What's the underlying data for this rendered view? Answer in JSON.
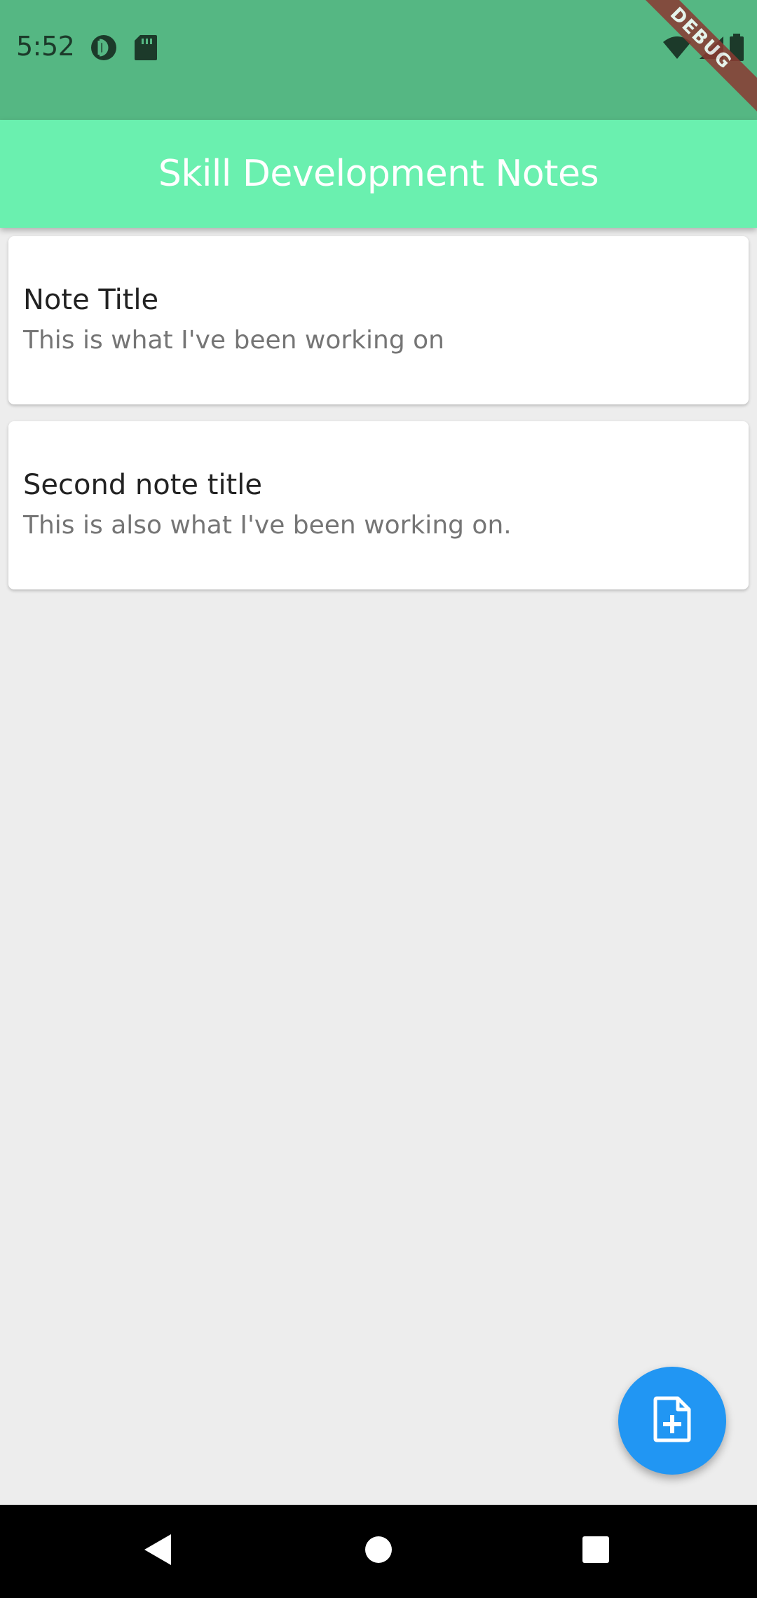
{
  "status_bar": {
    "time": "5:52",
    "left_icons": [
      "sync-icon",
      "sd-card-icon"
    ],
    "right_icons": [
      "wifi-icon",
      "signal-icon",
      "battery-icon"
    ],
    "debug_banner": "DEBUG",
    "color": "#55b783"
  },
  "app_bar": {
    "title": "Skill Development Notes",
    "color": "#6af0af"
  },
  "notes": [
    {
      "title": "Note Title",
      "body": "This is what I've been working on"
    },
    {
      "title": "Second note title",
      "body": "This is also what I've been working on."
    }
  ],
  "fab": {
    "icon": "note-add-icon",
    "color": "#2196f3"
  },
  "navigation": {
    "buttons": [
      "back-icon",
      "home-icon",
      "recents-icon"
    ]
  }
}
